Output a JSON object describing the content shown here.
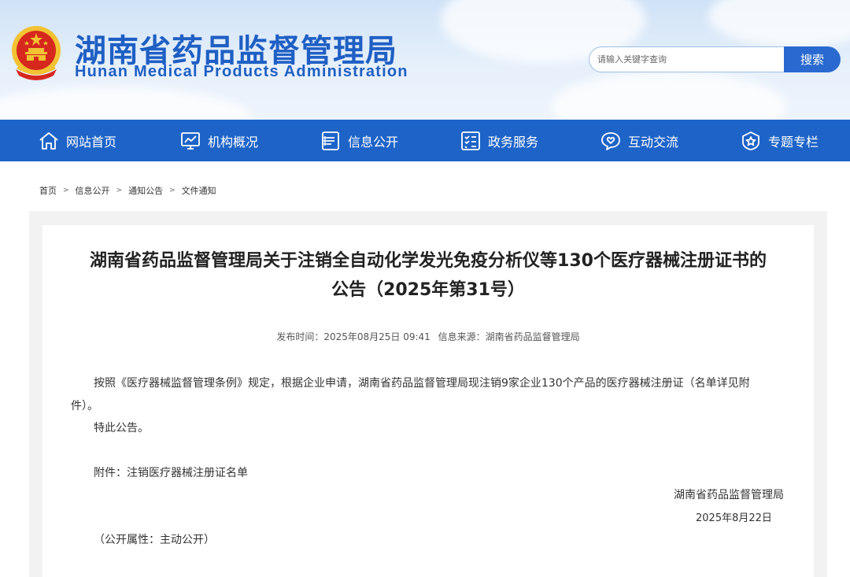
{
  "header": {
    "title_cn": "湖南省药品监督管理局",
    "title_en": "Hunan Medical Products Administration",
    "emblem_icon": "national-emblem-icon",
    "search": {
      "placeholder": "请输入关键字查询",
      "button_label": "搜索"
    }
  },
  "nav": {
    "items": [
      {
        "label": "网站首页",
        "icon": "home-icon"
      },
      {
        "label": "机构概况",
        "icon": "monitor-chart-icon"
      },
      {
        "label": "信息公开",
        "icon": "document-icon"
      },
      {
        "label": "政务服务",
        "icon": "checklist-icon"
      },
      {
        "label": "互动交流",
        "icon": "chat-heart-icon"
      },
      {
        "label": "专题专栏",
        "icon": "badge-star-icon"
      }
    ]
  },
  "breadcrumb": {
    "items": [
      "首页",
      "信息公开",
      "通知公告",
      "文件通知"
    ],
    "separator": ">"
  },
  "article": {
    "title_line1": "湖南省药品监督管理局关于注销全自动化学发光免疫分析仪等130个医疗器械注册证书的",
    "title_line2": "公告（2025年第31号）",
    "publish_time": "发布时间：2025年08月25日 09:41",
    "source": "信息来源：湖南省药品监督管理局",
    "paragraph1": "按照《医疗器械监督管理条例》规定，根据企业申请，湖南省药品监督管理局现注销9家企业130个产品的医疗器械注册证（名单详见附件）。",
    "paragraph2": "特此公告。",
    "attachment": "附件：注销医疗器械注册证名单",
    "signature_org": "湖南省药品监督管理局",
    "signature_date": "2025年8月22日",
    "public_attribute": "（公开属性：主动公开）"
  },
  "colors": {
    "brand_blue": "#1e64c8",
    "title_blue": "#1f5fc4",
    "search_button": "#2a6ad0"
  }
}
